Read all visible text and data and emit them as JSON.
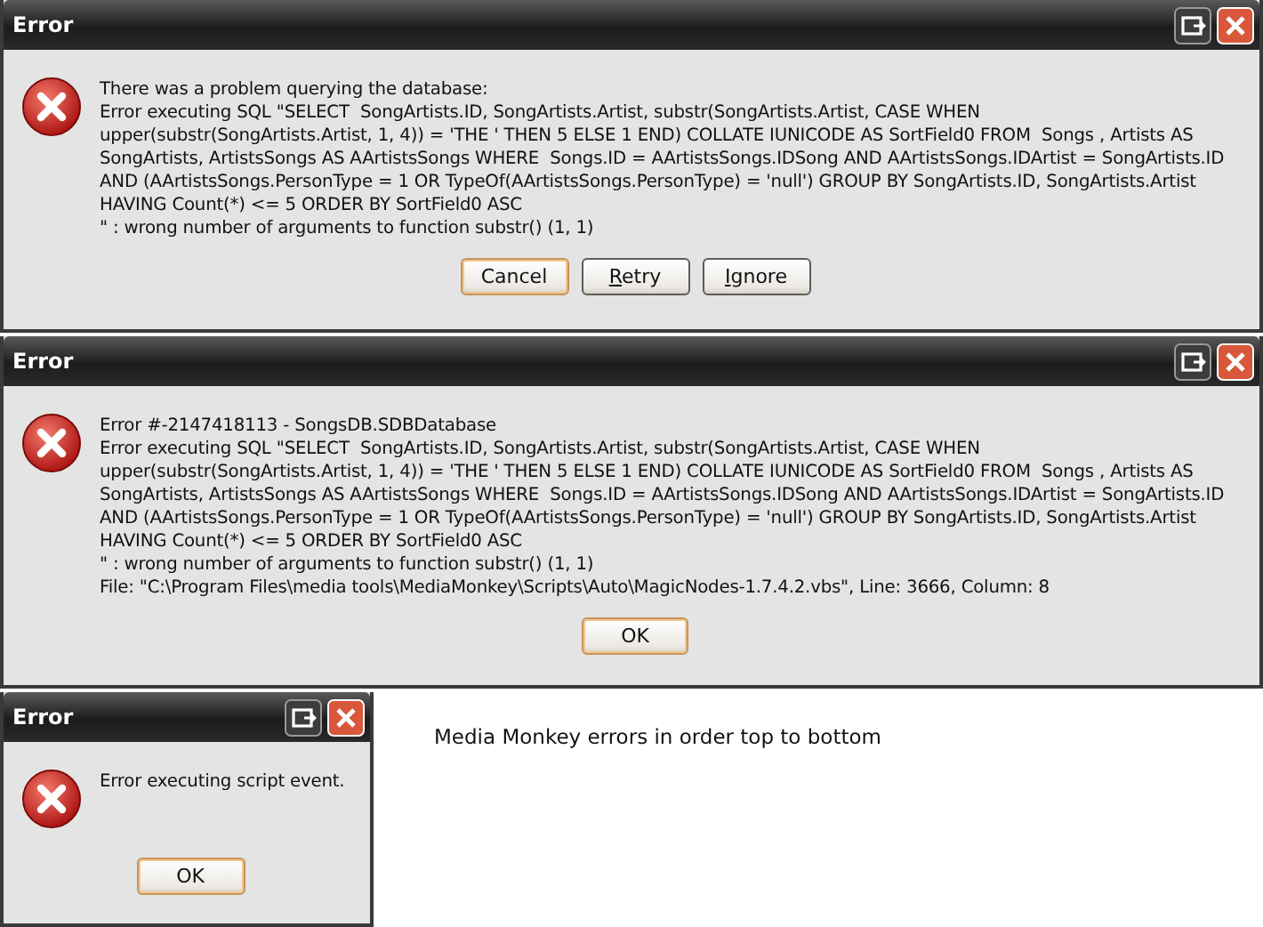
{
  "dialogs": [
    {
      "title": "Error",
      "lines": [
        "There was a problem querying the database:",
        "Error executing SQL \"SELECT  SongArtists.ID, SongArtists.Artist, substr(SongArtists.Artist, CASE WHEN",
        "upper(substr(SongArtists.Artist, 1, 4)) = 'THE ' THEN 5 ELSE 1 END) COLLATE IUNICODE AS SortField0 FROM  Songs , Artists AS",
        "SongArtists, ArtistsSongs AS AArtistsSongs WHERE  Songs.ID = AArtistsSongs.IDSong AND AArtistsSongs.IDArtist = SongArtists.ID",
        "AND (AArtistsSongs.PersonType = 1 OR TypeOf(AArtistsSongs.PersonType) = 'null') GROUP BY SongArtists.ID, SongArtists.Artist",
        "HAVING Count(*) <= 5 ORDER BY SortField0 ASC",
        "\" : wrong number of arguments to function substr() (1, 1)"
      ],
      "buttons": [
        {
          "label": "Cancel",
          "default": true,
          "underline_first": false
        },
        {
          "label": "Retry",
          "default": false,
          "underline_first": true
        },
        {
          "label": "Ignore",
          "default": false,
          "underline_first": true
        }
      ]
    },
    {
      "title": "Error",
      "lines": [
        "Error #-2147418113 - SongsDB.SDBDatabase",
        "Error executing SQL \"SELECT  SongArtists.ID, SongArtists.Artist, substr(SongArtists.Artist, CASE WHEN",
        "upper(substr(SongArtists.Artist, 1, 4)) = 'THE ' THEN 5 ELSE 1 END) COLLATE IUNICODE AS SortField0 FROM  Songs , Artists AS",
        "SongArtists, ArtistsSongs AS AArtistsSongs WHERE  Songs.ID = AArtistsSongs.IDSong AND AArtistsSongs.IDArtist = SongArtists.ID",
        "AND (AArtistsSongs.PersonType = 1 OR TypeOf(AArtistsSongs.PersonType) = 'null') GROUP BY SongArtists.ID, SongArtists.Artist",
        "HAVING Count(*) <= 5 ORDER BY SortField0 ASC",
        "\" : wrong number of arguments to function substr() (1, 1)",
        "File: \"C:\\Program Files\\media tools\\MediaMonkey\\Scripts\\Auto\\MagicNodes-1.7.4.2.vbs\", Line: 3666, Column: 8"
      ],
      "buttons": [
        {
          "label": "OK",
          "default": true,
          "underline_first": false
        }
      ]
    },
    {
      "title": "Error",
      "lines": [
        "Error executing script event."
      ],
      "buttons": [
        {
          "label": "OK",
          "default": true,
          "underline_first": false
        }
      ]
    }
  ],
  "caption": "Media Monkey errors in order top to bottom"
}
